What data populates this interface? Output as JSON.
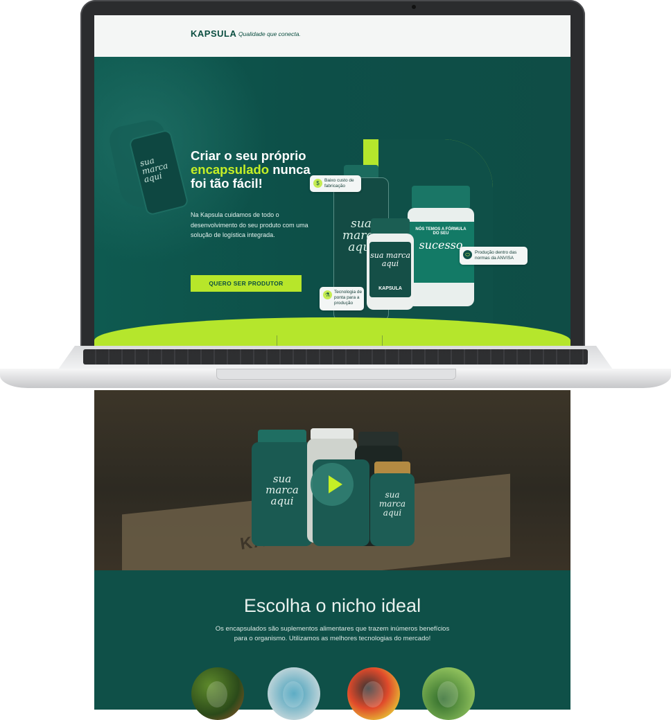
{
  "site": {
    "logo": "KAPSULA",
    "tagline": "Qualidade que conecta."
  },
  "hero": {
    "title_part1": "Criar o seu próprio ",
    "title_highlight": "encapsulado",
    "title_part2": " nunca foi tão fácil!",
    "description": "Na Kapsula cuidamos de todo o desenvolvimento do seu produto com uma solução de logística integrada.",
    "cta_label": "QUERO SER PRODUTOR"
  },
  "products": {
    "jar_label_script": "sua marca aqui",
    "jar_label_script_small": "sua marca aqui",
    "jar_big_top": "NÓS TEMOS A FÓRMULA DO SEU",
    "jar_big_word": "sucesso",
    "jar_brand": "KAPSULA"
  },
  "features": [
    {
      "icon": "coin-icon",
      "text": "Baixo custo de fabricação"
    },
    {
      "icon": "flask-icon",
      "text": "Tecnologia de ponta para a produção"
    },
    {
      "icon": "capsule-icon",
      "text": "Produção dentro das normas da ANVISA"
    }
  ],
  "video": {
    "jar_script": "sua marca aqui",
    "box_print": "KAPSULA"
  },
  "niche": {
    "title": "Escolha o nicho ideal",
    "description": "Os encapsulados são suplementos alimentares que trazem inúmeros benefícios para o organismo. Utilizamos as melhores tecnologias do mercado!"
  },
  "niche_items": [
    {
      "icon": "foods-icon"
    },
    {
      "icon": "slim-waist-icon"
    },
    {
      "icon": "glucose-meter-icon"
    },
    {
      "icon": "running-icon"
    }
  ],
  "colors": {
    "brand_dark": "#0f5048",
    "accent_lime": "#b5e62c",
    "highlight": "#c5ef26"
  }
}
